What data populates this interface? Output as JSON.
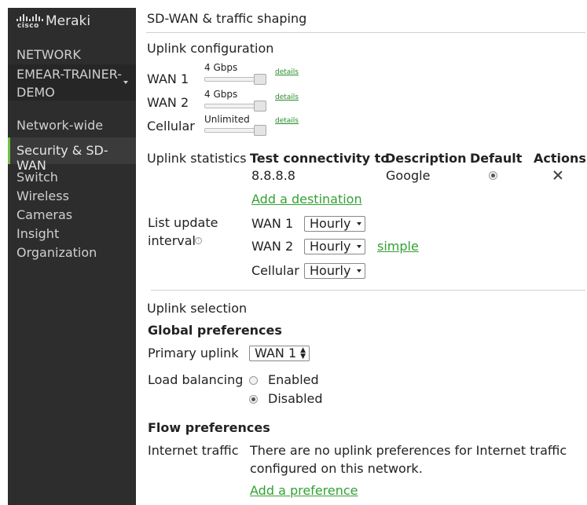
{
  "sidebar": {
    "brand_logo_text": "cisco",
    "brand_name": "Meraki",
    "network_label": "NETWORK",
    "network_name": "EMEAR-TRAINER-DEMO",
    "items": [
      {
        "label": "Network-wide"
      },
      {
        "label": "Security & SD-WAN",
        "active": true
      },
      {
        "label": "Switch"
      },
      {
        "label": "Wireless"
      },
      {
        "label": "Cameras"
      },
      {
        "label": "Insight"
      },
      {
        "label": "Organization"
      }
    ],
    "accent_color": "#6fbf4a"
  },
  "page": {
    "title": "SD-WAN & traffic shaping"
  },
  "uplink_config": {
    "heading": "Uplink configuration",
    "uplinks": [
      {
        "name": "WAN 1",
        "bandwidth": "4 Gbps",
        "details": "details",
        "level": 1.0
      },
      {
        "name": "WAN 2",
        "bandwidth": "4 Gbps",
        "details": "details",
        "level": 1.0
      },
      {
        "name": "Cellular",
        "bandwidth": "Unlimited",
        "details": "details",
        "level": 1.0
      }
    ]
  },
  "uplink_stats": {
    "label": "Uplink statistics",
    "headers": {
      "test": "Test connectivity to",
      "description": "Description",
      "default": "Default",
      "actions": "Actions"
    },
    "rows": [
      {
        "target": "8.8.8.8",
        "description": "Google",
        "default": true
      }
    ],
    "add_destination": "Add a destination",
    "list_update_label": "List update",
    "list_update_label2": "interval",
    "intervals": [
      {
        "name": "WAN 1",
        "value": "Hourly"
      },
      {
        "name": "WAN 2",
        "value": "Hourly"
      },
      {
        "name": "Cellular",
        "value": "Hourly"
      }
    ],
    "simple_link": "simple"
  },
  "uplink_selection": {
    "heading": "Uplink selection",
    "global_heading": "Global preferences",
    "primary_label": "Primary uplink",
    "primary_value": "WAN 1",
    "load_balancing_label": "Load balancing",
    "load_options": [
      {
        "label": "Enabled",
        "selected": false
      },
      {
        "label": "Disabled",
        "selected": true
      }
    ],
    "flow_heading": "Flow preferences",
    "internet_label": "Internet traffic",
    "internet_text_1": "There are no uplink preferences for Internet traffic",
    "internet_text_2": "configured on this network.",
    "add_preference": "Add a preference"
  },
  "colors": {
    "link_green": "#34a134",
    "sidebar_bg": "#2d2d2d"
  }
}
